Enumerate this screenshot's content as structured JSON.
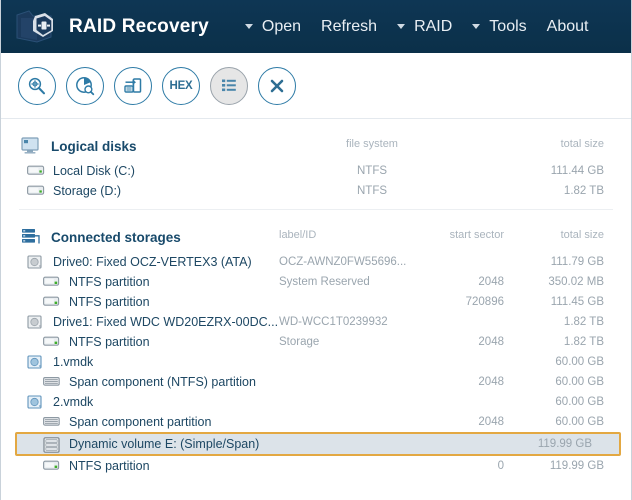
{
  "window": {
    "app_title": "RAID Recovery",
    "logo_icon": "raid-folder-logo-icon"
  },
  "menu": {
    "items": [
      {
        "label": "Open",
        "has_caret": true,
        "icon": "chevron-down-icon"
      },
      {
        "label": "Refresh",
        "has_caret": false,
        "icon": ""
      },
      {
        "label": "RAID",
        "has_caret": true,
        "icon": "chevron-down-icon"
      },
      {
        "label": "Tools",
        "has_caret": true,
        "icon": "chevron-down-icon"
      },
      {
        "label": "About",
        "has_caret": false,
        "icon": ""
      }
    ]
  },
  "toolbar": {
    "buttons": [
      {
        "name": "find-icon",
        "title": "Find",
        "active": false
      },
      {
        "name": "disk-scan-icon",
        "title": "Scan disk",
        "active": false
      },
      {
        "name": "save-image-icon",
        "title": "Save disk image",
        "active": false
      },
      {
        "name": "hex-icon",
        "title": "HEX",
        "active": false,
        "text": "HEX"
      },
      {
        "name": "list-view-icon",
        "title": "List view",
        "active": true
      },
      {
        "name": "close-icon",
        "title": "Close",
        "active": false
      }
    ]
  },
  "logical_disks": {
    "title": "Logical disks",
    "icon": "monitor-icon",
    "columns": {
      "file_system": "file system",
      "total_size": "total size"
    },
    "rows": [
      {
        "icon": "drive-icon",
        "label": "Local Disk (C:)",
        "file_system": "NTFS",
        "total_size": "111.44 GB"
      },
      {
        "icon": "drive-icon",
        "label": "Storage (D:)",
        "file_system": "NTFS",
        "total_size": "1.82 TB"
      }
    ]
  },
  "connected_storages": {
    "title": "Connected storages",
    "icon": "stacked-storage-icon",
    "columns": {
      "label_id": "label/ID",
      "start_sector": "start sector",
      "total_size": "total size"
    },
    "rows": [
      {
        "icon": "physical-disk-icon",
        "label": "Drive0: Fixed OCZ-VERTEX3 (ATA)",
        "label_id": "OCZ-AWNZ0FW55696...",
        "start_sector": "",
        "total_size": "111.79 GB",
        "indent": 1,
        "selected": false
      },
      {
        "icon": "partition-icon",
        "label": "NTFS partition",
        "label_id": "System Reserved",
        "start_sector": "2048",
        "total_size": "350.02 MB",
        "indent": 2,
        "selected": false
      },
      {
        "icon": "partition-icon",
        "label": "NTFS partition",
        "label_id": "",
        "start_sector": "720896",
        "total_size": "111.45 GB",
        "indent": 2,
        "selected": false
      },
      {
        "icon": "physical-disk-icon",
        "label": "Drive1: Fixed WDC WD20EZRX-00DC...",
        "label_id": "WD-WCC1T0239932",
        "start_sector": "",
        "total_size": "1.82 TB",
        "indent": 1,
        "selected": false
      },
      {
        "icon": "partition-icon",
        "label": "NTFS partition",
        "label_id": "Storage",
        "start_sector": "2048",
        "total_size": "1.82 TB",
        "indent": 2,
        "selected": false
      },
      {
        "icon": "vmdk-disk-icon",
        "label": "1.vmdk",
        "label_id": "",
        "start_sector": "",
        "total_size": "60.00 GB",
        "indent": 1,
        "selected": false
      },
      {
        "icon": "span-component-icon",
        "label": "Span component (NTFS) partition",
        "label_id": "",
        "start_sector": "2048",
        "total_size": "60.00 GB",
        "indent": 2,
        "selected": false
      },
      {
        "icon": "vmdk-disk-icon",
        "label": "2.vmdk",
        "label_id": "",
        "start_sector": "",
        "total_size": "60.00 GB",
        "indent": 1,
        "selected": false
      },
      {
        "icon": "span-component-icon",
        "label": "Span component partition",
        "label_id": "",
        "start_sector": "2048",
        "total_size": "60.00 GB",
        "indent": 2,
        "selected": false
      },
      {
        "icon": "dynamic-volume-icon",
        "label": "Dynamic volume E: (Simple/Span)",
        "label_id": "",
        "start_sector": "",
        "total_size": "119.99 GB",
        "indent": 1,
        "selected": true
      },
      {
        "icon": "partition-icon",
        "label": "NTFS partition",
        "label_id": "",
        "start_sector": "0",
        "total_size": "119.99 GB",
        "indent": 2,
        "selected": false
      }
    ]
  },
  "colors": {
    "titlebar": "#0d3350",
    "accent_blue": "#2e7ba6",
    "heading": "#184a6b",
    "row_text": "#1d4763",
    "muted": "#9aa5ae",
    "selection_border": "#e3a842",
    "selection_fill": "#dce3e9",
    "green_led": "#3fae29"
  }
}
